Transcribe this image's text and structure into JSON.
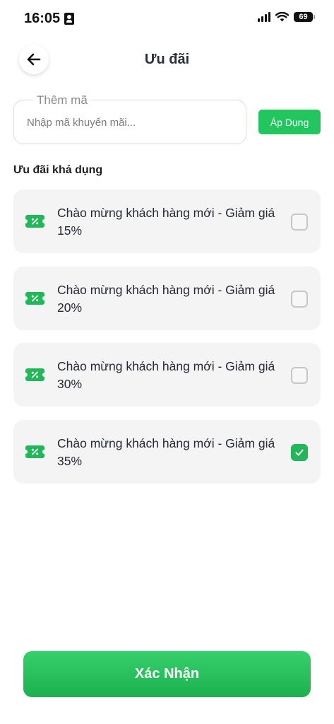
{
  "status_bar": {
    "time": "16:05",
    "battery": "69",
    "icons": [
      "contact-card-icon",
      "cellular-signal-icon",
      "wifi-icon",
      "battery-icon"
    ]
  },
  "header": {
    "title": "Ưu đãi",
    "back_icon": "arrow-left-icon"
  },
  "promo": {
    "legend": "Thêm mã",
    "placeholder": "Nhập mã khuyến mãi...",
    "value": "",
    "apply_label": "Áp Dụng"
  },
  "section_title": "Ưu đãi khả dụng",
  "vouchers": [
    {
      "label": "Chào mừng khách hàng mới - Giảm giá 15%",
      "checked": false,
      "icon": "ticket-percent-icon"
    },
    {
      "label": "Chào mừng khách hàng mới - Giảm giá 20%",
      "checked": false,
      "icon": "ticket-percent-icon"
    },
    {
      "label": "Chào mừng khách hàng mới - Giảm giá 30%",
      "checked": false,
      "icon": "ticket-percent-icon"
    },
    {
      "label": "Chào mừng khách hàng mới - Giảm giá 35%",
      "checked": true,
      "icon": "ticket-percent-icon"
    }
  ],
  "confirm_label": "Xác Nhận",
  "colors": {
    "accent": "#22c55e",
    "card_bg": "#f4f4f5",
    "text": "#252a35"
  }
}
